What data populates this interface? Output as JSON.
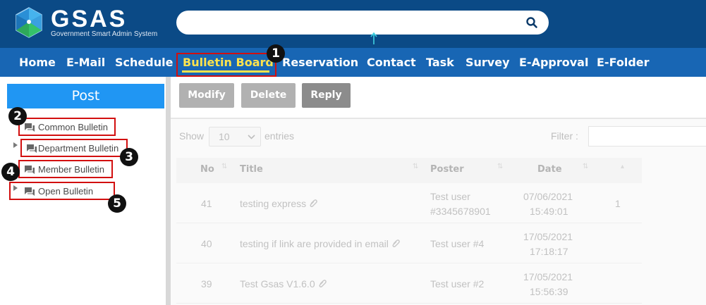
{
  "brand": {
    "name": "GSAS",
    "tagline": "Government Smart Admin System",
    "colors": {
      "header": "#0b4a86",
      "nav": "#1866b4",
      "active_nav": "#ffe34d",
      "post_button": "#2096f3",
      "highlight_box": "#d20f0f"
    }
  },
  "search": {
    "placeholder": "",
    "icon": "search-icon"
  },
  "nav": {
    "items": [
      {
        "label": "Home"
      },
      {
        "label": "E-Mail"
      },
      {
        "label": "Schedule"
      },
      {
        "label": "Bulletin Board",
        "active": true
      },
      {
        "label": "Reservation"
      },
      {
        "label": "Contact"
      },
      {
        "label": "Task"
      },
      {
        "label": "Survey"
      },
      {
        "label": "E-Approval"
      },
      {
        "label": "E-Folder"
      }
    ]
  },
  "badges": [
    "1",
    "2",
    "3",
    "4",
    "5"
  ],
  "sidebar": {
    "post_label": "Post",
    "items": [
      {
        "label": "Common Bulletin",
        "icon": "chat-icon"
      },
      {
        "label": "Department Bulletin",
        "icon": "chat-icon"
      },
      {
        "label": "Member Bulletin",
        "icon": "chat-icon"
      },
      {
        "label": "Open Bulletin",
        "icon": "chat-icon"
      }
    ]
  },
  "toolbar": {
    "modify_label": "Modify",
    "delete_label": "Delete",
    "reply_label": "Reply"
  },
  "table": {
    "show_label": "Show",
    "entries_value": "10",
    "entries_label": "entries",
    "filter_label": "Filter :",
    "filter_value": "",
    "headers": [
      "No",
      "Title",
      "Poster",
      "Date"
    ],
    "rows": [
      {
        "no": "41",
        "title": "testing express",
        "poster_line1": "Test user",
        "poster_line2": "#3345678901",
        "date_line1": "07/06/2021",
        "date_line2": "15:49:01",
        "extra": "1"
      },
      {
        "no": "40",
        "title": "testing if link are provided in email",
        "poster_line1": "Test user #4",
        "poster_line2": "",
        "date_line1": "17/05/2021",
        "date_line2": "17:18:17",
        "extra": ""
      },
      {
        "no": "39",
        "title": "Test Gsas V1.6.0",
        "poster_line1": "Test user #2",
        "poster_line2": "",
        "date_line1": "17/05/2021",
        "date_line2": "15:56:39",
        "extra": ""
      }
    ]
  }
}
